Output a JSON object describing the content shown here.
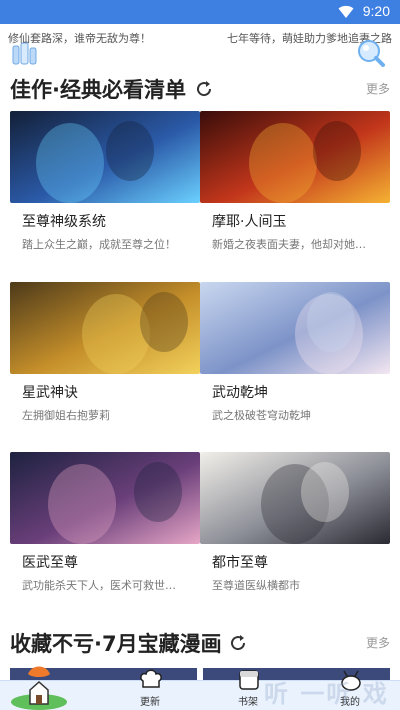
{
  "status_bar": {
    "time": "9:20"
  },
  "header": {
    "tagline_left": "修仙套路深，谁帝无敌为尊！",
    "tagline_right": "七年等待，萌娃助力爹地追妻之路"
  },
  "sections": [
    {
      "title": "佳作·经典必看清单",
      "more": "更多",
      "items": [
        {
          "name": "至尊神级系统",
          "desc": "踏上众生之巅，成就至尊之位！",
          "palette": [
            "#132038",
            "#2b5aa8",
            "#6bd1ff"
          ]
        },
        {
          "name": "摩耶·人间玉",
          "desc": "新婚之夜表面夫妻，他却对她…",
          "palette": [
            "#3a0d0a",
            "#c2361b",
            "#f5b233"
          ]
        },
        {
          "name": "星武神诀",
          "desc": "左拥御姐右抱萝莉",
          "palette": [
            "#4d3a1a",
            "#c58f2a",
            "#f2d15c"
          ]
        },
        {
          "name": "武动乾坤",
          "desc": "武之极破苍穹动乾坤",
          "palette": [
            "#c9d7ef",
            "#7d93c8",
            "#f3e6f1"
          ]
        },
        {
          "name": "医武至尊",
          "desc": "武功能杀天下人，医术可救世…",
          "palette": [
            "#1d2240",
            "#6a3f7a",
            "#e6a6c6"
          ]
        },
        {
          "name": "都市至尊",
          "desc": "至尊道医纵横都市",
          "palette": [
            "#f2efe9",
            "#8d8f98",
            "#2a2a33"
          ]
        }
      ]
    },
    {
      "title": "收藏不亏·7月宝藏漫画",
      "more": "更多"
    }
  ],
  "bottom_nav": [
    {
      "label": "",
      "icon": "home-house-icon"
    },
    {
      "label": "更新",
      "icon": "chef-hat-icon"
    },
    {
      "label": "书架",
      "icon": "book-shelf-icon"
    },
    {
      "label": "",
      "icon": "category-icon"
    },
    {
      "label": "我的",
      "icon": "profile-icon"
    }
  ],
  "watermark": "听  一听  戏",
  "colors": {
    "accent": "#3e7fe2",
    "statusbar": "#3e7fe2",
    "nav_bg": "#eaf2fd"
  }
}
